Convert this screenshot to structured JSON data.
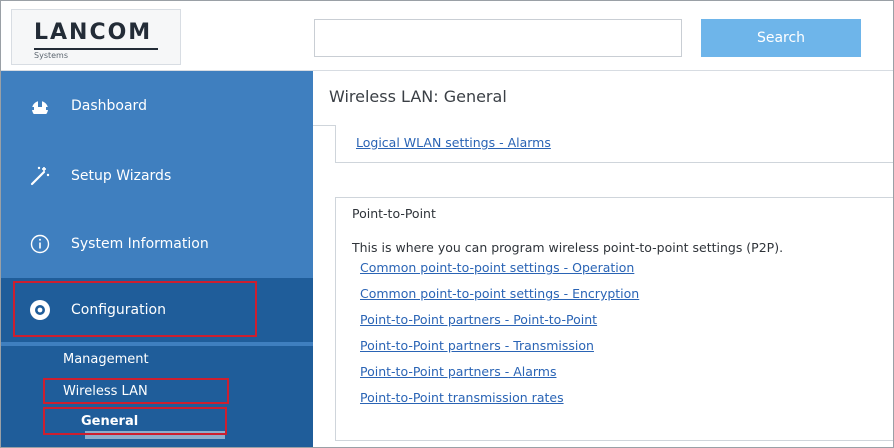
{
  "header": {
    "logo": {
      "brand": "LANCOM",
      "sub": "Systems"
    },
    "search": {
      "value": "",
      "placeholder": "",
      "button_label": "Search"
    }
  },
  "sidebar": {
    "items": [
      {
        "label": "Dashboard",
        "icon": "dashboard-icon"
      },
      {
        "label": "Setup Wizards",
        "icon": "wand-icon"
      },
      {
        "label": "System Information",
        "icon": "info-icon"
      },
      {
        "label": "Configuration",
        "icon": "gear-icon"
      }
    ],
    "subitems": [
      {
        "label": "Management"
      },
      {
        "label": "Wireless LAN"
      },
      {
        "label": "General"
      }
    ]
  },
  "main": {
    "title": "Wireless LAN: General",
    "logical_card": {
      "link": "Logical WLAN settings - Alarms"
    },
    "p2p_card": {
      "title": "Point-to-Point",
      "description": "This is where you can program wireless point-to-point settings (P2P).",
      "links": [
        "Common point-to-point settings - Operation",
        "Common point-to-point settings - Encryption",
        "Point-to-Point partners - Point-to-Point",
        "Point-to-Point partners - Transmission",
        "Point-to-Point partners - Alarms",
        "Point-to-Point transmission rates"
      ]
    }
  },
  "colors": {
    "sidebar_bg": "#3f7fbf",
    "sidebar_active": "#1f5d9a",
    "search_button": "#6eb5ea",
    "link": "#2a64b5",
    "highlight_box": "#cc1f2f"
  }
}
